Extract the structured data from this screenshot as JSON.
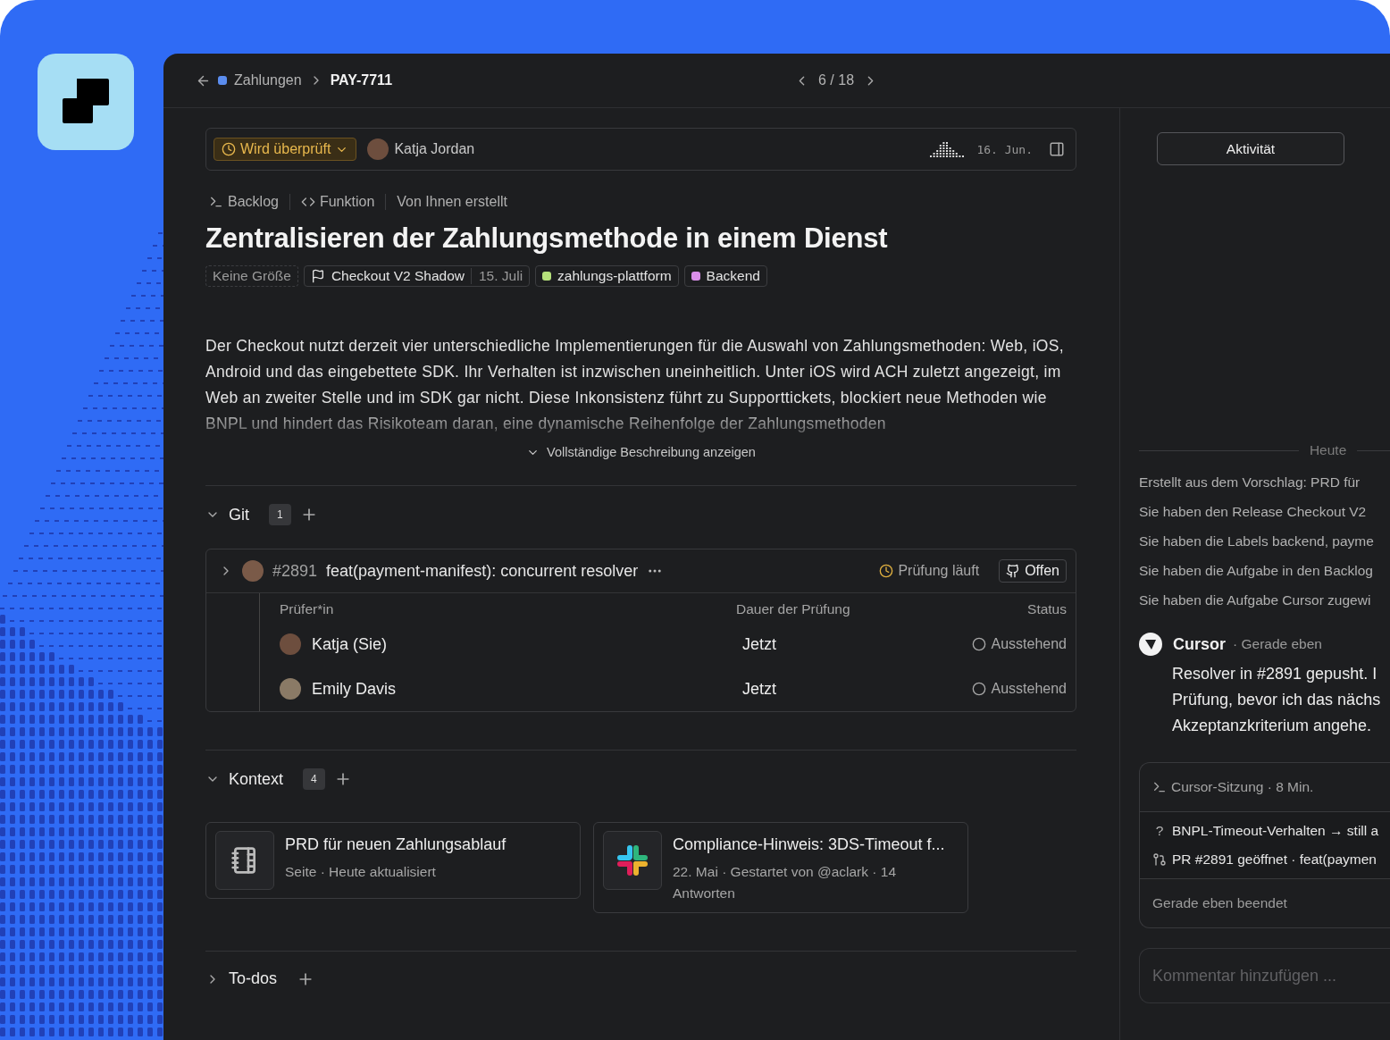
{
  "header": {
    "breadcrumb": [
      {
        "label": "Zahlungen",
        "color": "#5b8def"
      },
      {
        "label": "PAY-7711"
      }
    ],
    "position": "6 / 18"
  },
  "status_bar": {
    "status": "Wird überprüft",
    "assignee": "Katja Jordan",
    "date": "16. Jun."
  },
  "meta": [
    {
      "kind": "backlog",
      "label": "Backlog"
    },
    {
      "kind": "feature",
      "label": "Funktion"
    },
    {
      "kind": "plain",
      "label": "Von Ihnen erstellt"
    }
  ],
  "title": "Zentralisieren der Zahlungsmethode in einem Dienst",
  "chips": [
    {
      "kind": "size",
      "label": "Keine Größe"
    },
    {
      "kind": "release",
      "label": "Checkout V2 Shadow",
      "date": "15. Juli"
    },
    {
      "kind": "label",
      "label": "zahlungs-plattform",
      "color": "#b5e07b"
    },
    {
      "kind": "label",
      "label": "Backend",
      "color": "#d98ee8"
    }
  ],
  "description": {
    "text": "Der Checkout nutzt derzeit vier unterschiedliche Implementierungen für die Auswahl von Zahlungsmethoden: Web, iOS, Android und das eingebettete SDK. Ihr Verhalten ist inzwischen uneinheitlich. Unter iOS wird ACH zuletzt angezeigt, im Web an zweiter Stelle und im SDK gar nicht. Diese Inkonsistenz führt zu Supporttickets, blockiert neue Methoden wie BNPL und hindert das Risikoteam daran, eine dynamische Reihenfolge der Zahlungsmethoden",
    "expand_label": "Vollständige Beschreibung anzeigen"
  },
  "sections": [
    {
      "kind": "git",
      "title": "Git",
      "count": "1",
      "expanded": true,
      "pull_request": {
        "number": "#2891",
        "title": "feat(payment-manifest): concurrent resolver",
        "check": "Prüfung läuft",
        "state": "Offen",
        "columns": [
          "Prüfer*in",
          "Dauer der Prüfung",
          "Status"
        ],
        "reviewers": [
          {
            "name": "Katja (Sie)",
            "duration": "Jetzt",
            "status": "Ausstehend"
          },
          {
            "name": "Emily Davis",
            "duration": "Jetzt",
            "status": "Ausstehend"
          }
        ]
      }
    },
    {
      "kind": "context",
      "title": "Kontext",
      "count": "4",
      "expanded": true,
      "cards": [
        {
          "kind": "page",
          "title": "PRD für neuen Zahlungsablauf",
          "subtitle": "Seite · Heute aktualisiert"
        },
        {
          "kind": "slack",
          "title": "Compliance-Hinweis: 3DS-Timeout f...",
          "subtitle": "22. Mai · Gestartet von @aclark · 14 Antworten"
        }
      ]
    },
    {
      "title": "To-dos",
      "expanded": false
    }
  ],
  "activity_panel": {
    "tabs": [
      {
        "label": "Aktivität",
        "selected": true
      }
    ],
    "day": "Heute",
    "events": [
      "Erstellt aus dem Vorschlag: PRD für",
      "Sie haben den Release Checkout V2",
      "Sie haben die Labels backend, payme",
      "Sie haben die Aufgabe in den Backlog",
      "Sie haben die Aufgabe Cursor zugewi"
    ],
    "comment": {
      "author": "Cursor",
      "time": "· Gerade eben",
      "lines": [
        "Resolver in #2891 gepusht. I",
        "Prüfung, bevor ich das nächs",
        "Akzeptanzkriterium angehe."
      ]
    },
    "session": {
      "title": "Cursor-Sitzung · 8 Min.",
      "items": [
        {
          "kind": "question",
          "marker": "?",
          "text": "BNPL-Timeout-Verhalten → still a"
        },
        {
          "kind": "pr",
          "text": "PR #2891 geöffnet · feat(paymen"
        }
      ],
      "footer": "Gerade eben beendet"
    },
    "composer": {
      "placeholder": "Kommentar hinzufügen ..."
    }
  }
}
